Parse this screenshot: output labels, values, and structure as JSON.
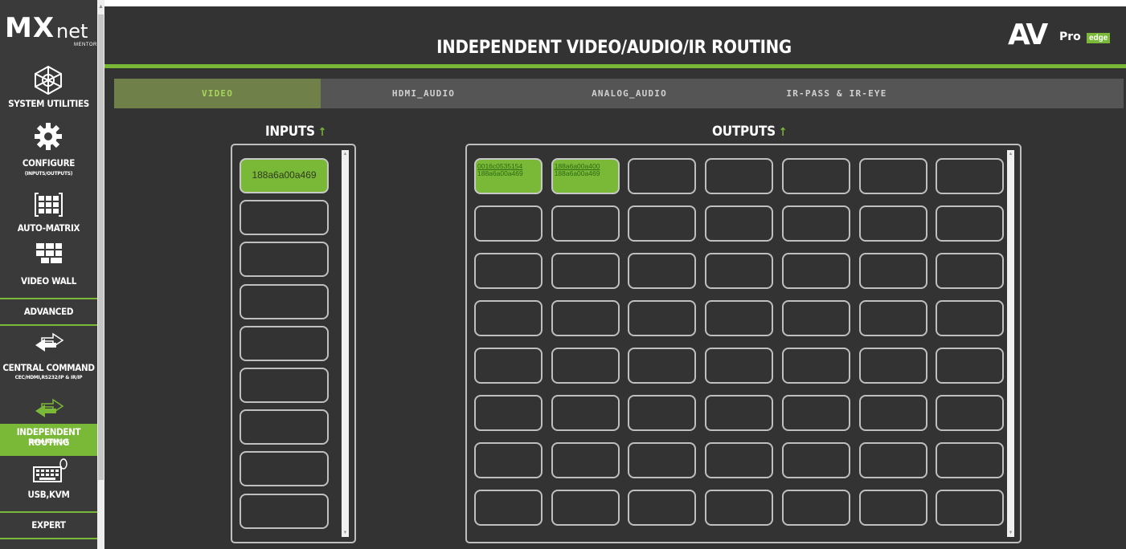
{
  "app": {
    "logo_main": "MX",
    "logo_net": "net",
    "logo_sub": "MENTOR"
  },
  "sidebar": {
    "items": [
      {
        "label": "SYSTEM UTILITIES",
        "sub": "",
        "icon": "network-globe-icon"
      },
      {
        "label": "CONFIGURE",
        "sub": "(INPUTS/OUTPUTS)",
        "icon": "gear-wrench-icon"
      },
      {
        "label": "AUTO-MATRIX",
        "sub": "",
        "icon": "matrix-grid-icon"
      },
      {
        "label": "VIDEO WALL",
        "sub": "",
        "icon": "video-wall-icon"
      },
      {
        "label": "ADVANCED",
        "sub": "",
        "icon": ""
      },
      {
        "label": "CENTRAL COMMAND",
        "sub": "CEC/HDMI,RS232/IP & IR/IP",
        "icon": "double-arrow-icon"
      },
      {
        "label": "INDEPENDENT ROUTING",
        "sub": "VIDEO/AUDIO/IR",
        "icon": "double-arrow-icon",
        "active": true
      },
      {
        "label": "USB,KVM",
        "sub": "",
        "icon": "keyboard-mouse-icon"
      },
      {
        "label": "EXPERT",
        "sub": "",
        "icon": ""
      }
    ]
  },
  "header": {
    "title": "INDEPENDENT VIDEO/AUDIO/IR ROUTING",
    "brand_av": "AV",
    "brand_pro": "Pro",
    "brand_edge": "edge"
  },
  "tabs": [
    {
      "label": "VIDEO",
      "active": true
    },
    {
      "label": "HDMI_AUDIO",
      "active": false
    },
    {
      "label": "ANALOG_AUDIO",
      "active": false
    },
    {
      "label": "IR-PASS & IR-EYE",
      "active": false
    }
  ],
  "inputs": {
    "heading": "INPUTS",
    "arrow": "↑",
    "slots": [
      "188a6a00a469",
      "",
      "",
      "",
      "",
      "",
      "",
      "",
      ""
    ]
  },
  "outputs": {
    "heading": "OUTPUTS",
    "arrow": "↑",
    "columns": 7,
    "rows": 8,
    "filled": [
      {
        "line1": "0016c0535154",
        "line2": "188a6a00a469"
      },
      {
        "line1": "188a6a00a400",
        "line2": "188a6a00a469"
      }
    ]
  },
  "colors": {
    "accent": "#7ab837",
    "panel_bg": "#333333",
    "sidebar_bg": "#3a3a3a",
    "tab_bg": "#555555",
    "tab_active_bg": "#6f8049"
  }
}
